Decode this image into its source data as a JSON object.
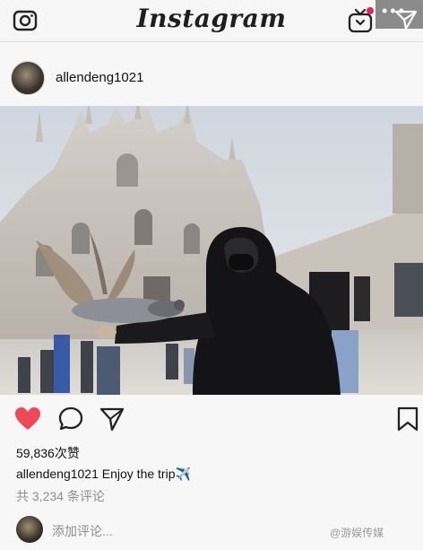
{
  "header": {
    "logo": "Instagram",
    "camera_icon": "camera-icon",
    "igtv_icon": "igtv-icon",
    "direct_icon": "direct-message-icon",
    "more_dots": "•••",
    "notification_color": "#e0245e"
  },
  "post": {
    "username": "allendeng1021",
    "more_label": "···",
    "likes": "59,836次赞",
    "caption_user": "allendeng1021",
    "caption_text": "Enjoy the trip✈️",
    "comments_count": "共 3,234 条评论",
    "add_comment_placeholder": "添加评论...",
    "like_color": "#ed4956"
  },
  "watermark": "@游娱传媒"
}
